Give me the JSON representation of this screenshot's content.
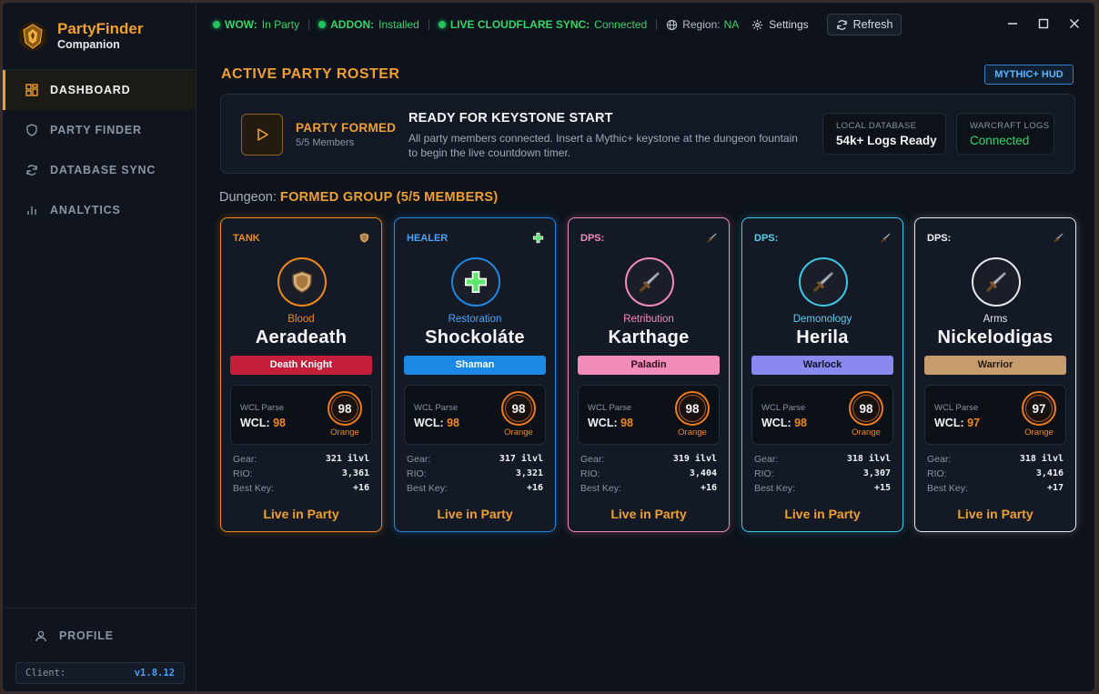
{
  "app": {
    "title": "PartyFinder",
    "subtitle": "Companion"
  },
  "sidebar": {
    "items": [
      {
        "label": "DASHBOARD",
        "icon": "dashboard-icon",
        "active": true
      },
      {
        "label": "PARTY FINDER",
        "icon": "shield-icon",
        "active": false
      },
      {
        "label": "DATABASE SYNC",
        "icon": "sync-icon",
        "active": false
      },
      {
        "label": "ANALYTICS",
        "icon": "bar-chart-icon",
        "active": false
      }
    ],
    "profile": "PROFILE",
    "client_label": "Client:",
    "client_version": "v1.8.12"
  },
  "topbar": {
    "wow_label": "WOW:",
    "wow_value": "In Party",
    "addon_label": "ADDON:",
    "addon_value": "Installed",
    "sync_label": "LIVE CLOUDFLARE SYNC:",
    "sync_value": "Connected",
    "region_label": "Region:",
    "region_value": "NA",
    "settings": "Settings",
    "refresh": "Refresh"
  },
  "main": {
    "title": "ACTIVE PARTY ROSTER",
    "hud_button": "MYTHIC+ HUD",
    "banner": {
      "status_title": "PARTY FORMED",
      "status_sub": "5/5 Members",
      "ready_title": "READY FOR KEYSTONE START",
      "ready_desc": "All party members connected. Insert a Mythic+ keystone at the dungeon fountain to begin the live countdown timer.",
      "db_label": "LOCAL DATABASE",
      "db_value": "54k+ Logs Ready",
      "wcl_label": "WARCRAFT LOGS",
      "wcl_value": "Connected"
    },
    "dungeon_label": "Dungeon:",
    "dungeon_value": "FORMED GROUP (5/5 MEMBERS)"
  },
  "labels": {
    "wcl_parse": "WCL Parse",
    "wcl": "WCL:",
    "gear": "Gear:",
    "rio": "RIO:",
    "best_key": "Best Key:",
    "live": "Live in Party"
  },
  "colors": {
    "accent": "#f0a030",
    "tank": "#f08a1a",
    "healer": "#1e88e5",
    "paladin": "#f48cba",
    "warlock": "#8888ee",
    "warrior": "#c69b6d",
    "dk": "#c41e3a",
    "online": "#22c45e"
  },
  "members": [
    {
      "role": "TANK",
      "role_icon": "shield-icon",
      "avatar_icon": "shield-icon",
      "spec": "Blood",
      "name": "Aeradeath",
      "class": "Death Knight",
      "wcl": "98",
      "parse_color": "Orange",
      "gear": "321 ilvl",
      "rio": "3,361",
      "key": "+16"
    },
    {
      "role": "HEALER",
      "role_icon": "plus-icon",
      "avatar_icon": "plus-icon",
      "spec": "Restoration",
      "name": "Shockoláte",
      "class": "Shaman",
      "wcl": "98",
      "parse_color": "Orange",
      "gear": "317 ilvl",
      "rio": "3,321",
      "key": "+16"
    },
    {
      "role": "DPS:",
      "role_icon": "sword-icon",
      "avatar_icon": "sword-icon",
      "spec": "Retribution",
      "name": "Karthage",
      "class": "Paladin",
      "wcl": "98",
      "parse_color": "Orange",
      "gear": "319 ilvl",
      "rio": "3,404",
      "key": "+16"
    },
    {
      "role": "DPS:",
      "role_icon": "sword-icon",
      "avatar_icon": "sword-icon",
      "spec": "Demonology",
      "name": "Herila",
      "class": "Warlock",
      "wcl": "98",
      "parse_color": "Orange",
      "gear": "318 ilvl",
      "rio": "3,307",
      "key": "+15"
    },
    {
      "role": "DPS:",
      "role_icon": "sword-icon",
      "avatar_icon": "sword-icon",
      "spec": "Arms",
      "name": "Nickelodigas",
      "class": "Warrior",
      "wcl": "97",
      "parse_color": "Orange",
      "gear": "318 ilvl",
      "rio": "3,416",
      "key": "+17"
    }
  ]
}
